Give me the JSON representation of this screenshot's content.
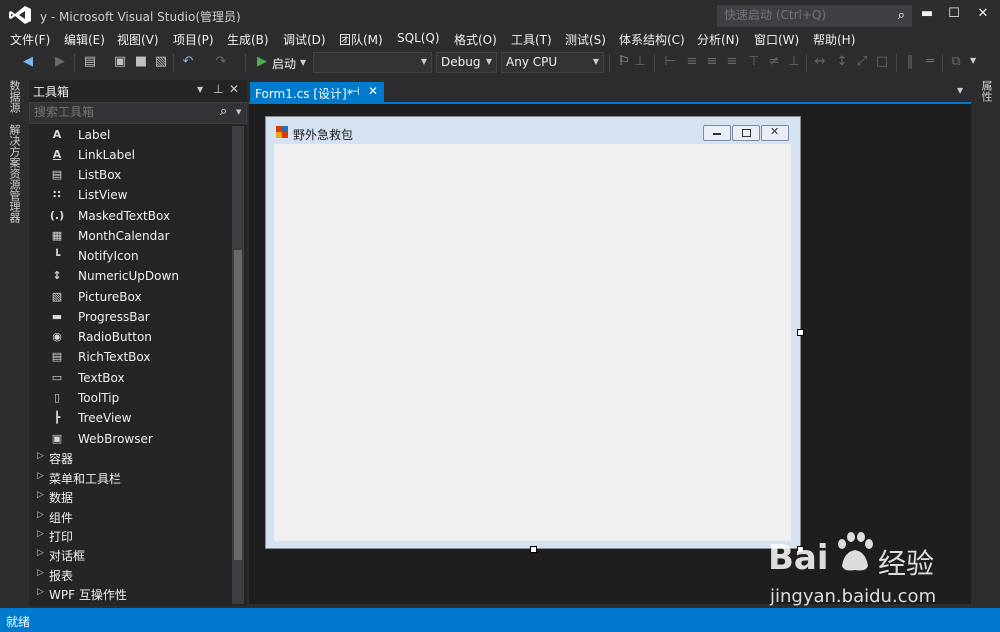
{
  "window": {
    "title": "y - Microsoft Visual Studio(管理员)",
    "quick_launch_placeholder": "快速启动 (Ctrl+Q)",
    "minimize": "▬",
    "maximize": "☐",
    "close": "✕"
  },
  "menu": [
    "文件(F)",
    "编辑(E)",
    "视图(V)",
    "项目(P)",
    "生成(B)",
    "调试(D)",
    "团队(M)",
    "SQL(Q)",
    "格式(O)",
    "工具(T)",
    "测试(S)",
    "体系结构(C)",
    "分析(N)",
    "窗口(W)",
    "帮助(H)"
  ],
  "toolbar": {
    "start_label": "启动",
    "config": "Debug",
    "platform": "Any CPU"
  },
  "left_strip": {
    "server_explorer": "数据源",
    "solution_explorer": "解决方案资源管理器"
  },
  "right_strip": {
    "properties": "属性"
  },
  "toolbox": {
    "title": "工具箱",
    "search_placeholder": "搜索工具箱",
    "items": [
      {
        "label": "Label",
        "icon": "label-icon"
      },
      {
        "label": "LinkLabel",
        "icon": "linklabel-icon"
      },
      {
        "label": "ListBox",
        "icon": "listbox-icon"
      },
      {
        "label": "ListView",
        "icon": "listview-icon"
      },
      {
        "label": "MaskedTextBox",
        "icon": "maskedtextbox-icon"
      },
      {
        "label": "MonthCalendar",
        "icon": "monthcalendar-icon"
      },
      {
        "label": "NotifyIcon",
        "icon": "notifyicon-icon"
      },
      {
        "label": "NumericUpDown",
        "icon": "numericupdown-icon"
      },
      {
        "label": "PictureBox",
        "icon": "picturebox-icon"
      },
      {
        "label": "ProgressBar",
        "icon": "progressbar-icon"
      },
      {
        "label": "RadioButton",
        "icon": "radiobutton-icon"
      },
      {
        "label": "RichTextBox",
        "icon": "richtextbox-icon"
      },
      {
        "label": "TextBox",
        "icon": "textbox-icon"
      },
      {
        "label": "ToolTip",
        "icon": "tooltip-icon"
      },
      {
        "label": "TreeView",
        "icon": "treeview-icon"
      },
      {
        "label": "WebBrowser",
        "icon": "webbrowser-icon"
      }
    ],
    "categories": [
      "容器",
      "菜单和工具栏",
      "数据",
      "组件",
      "打印",
      "对话框",
      "报表",
      "WPF 互操作性"
    ]
  },
  "document": {
    "tab_label": "Form1.cs [设计]*",
    "form_caption": "野外急救包"
  },
  "status": {
    "text": "就绪"
  },
  "watermark": {
    "brand": "Bai",
    "brand_tail": "经验",
    "url": "jingyan.baidu.com"
  },
  "colors": {
    "accent": "#007acc",
    "chrome": "#2d2d30",
    "panel": "#252526",
    "editor": "#1e1e1e"
  }
}
